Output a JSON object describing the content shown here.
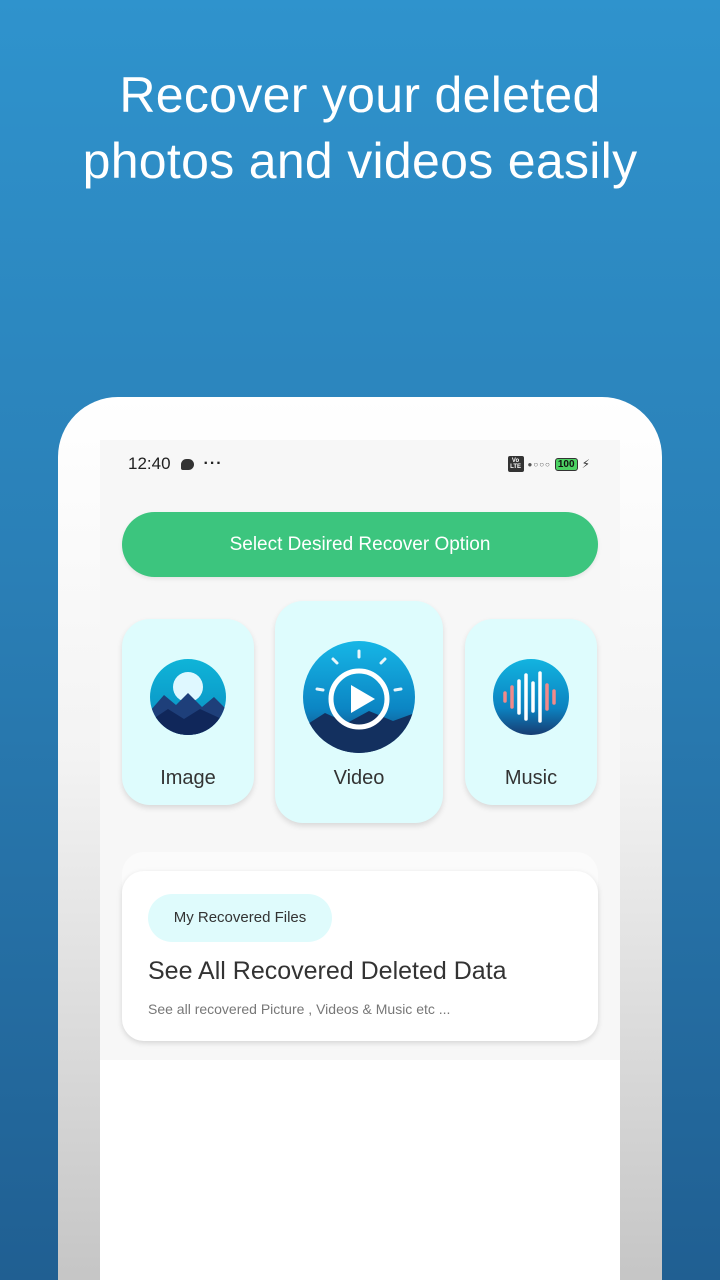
{
  "headline": {
    "line1": "Recover your deleted",
    "line2": "photos and videos easily"
  },
  "status_bar": {
    "time": "12:40",
    "more": "···",
    "network": "Vo LTE",
    "signal": "●○○○",
    "battery": "100"
  },
  "banner": {
    "label": "Select Desired Recover Option"
  },
  "options": [
    {
      "label": "Image",
      "icon": "image-icon"
    },
    {
      "label": "Video",
      "icon": "play-icon"
    },
    {
      "label": "Music",
      "icon": "audio-wave-icon"
    }
  ],
  "recovered": {
    "tag": "My Recovered Files",
    "title": "See All Recovered Deleted Data",
    "subtitle": "See all recovered Picture , Videos & Music etc ..."
  },
  "colors": {
    "background_top": "#2f93cd",
    "background_bottom": "#205f92",
    "banner": "#3cc57e",
    "card": "#defcfd"
  }
}
